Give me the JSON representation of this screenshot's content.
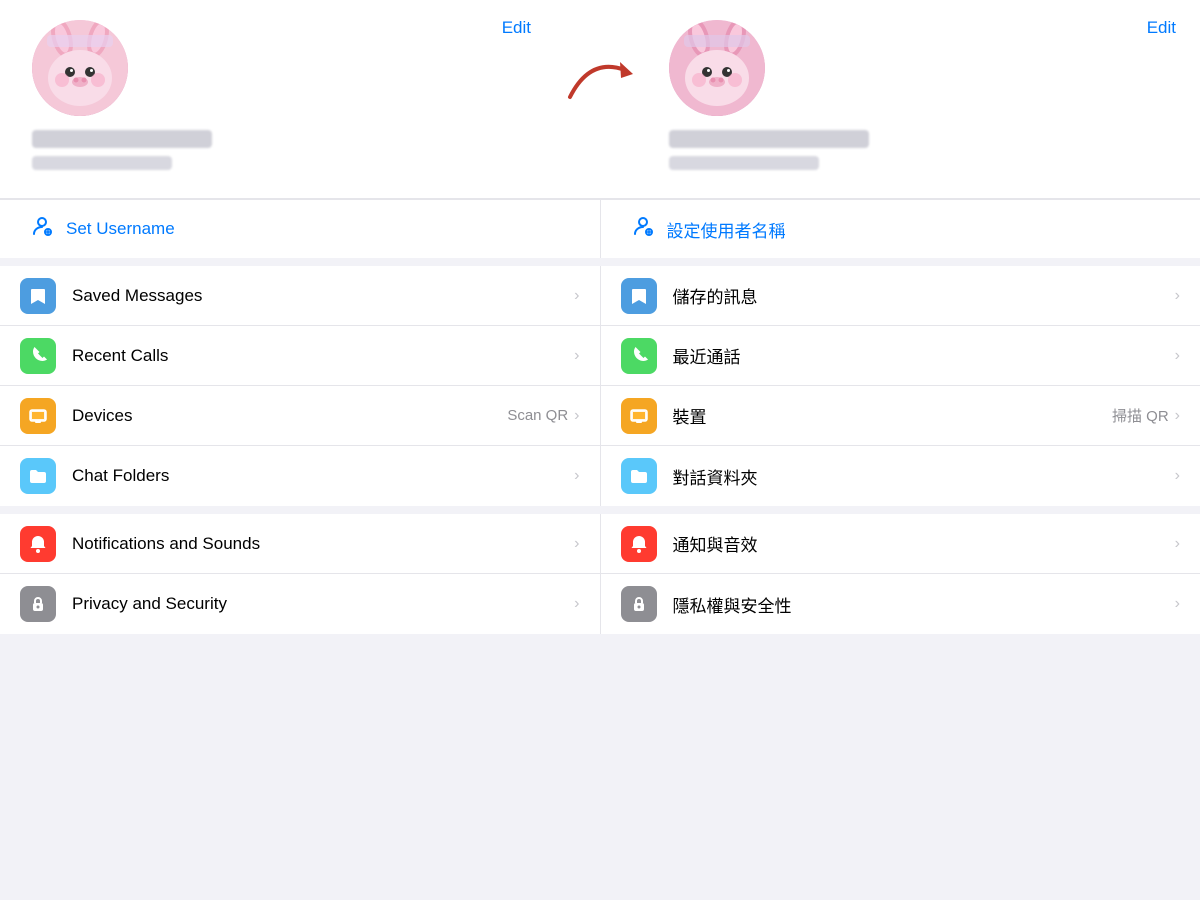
{
  "header": {
    "edit_label": "Edit"
  },
  "left_profile": {
    "edit_label": "Edit"
  },
  "right_profile": {
    "edit_label": "Edit"
  },
  "username": {
    "left_label": "Set Username",
    "right_label": "設定使用者名稱"
  },
  "menu_groups": [
    {
      "items_left": [
        {
          "icon": "bookmark",
          "label": "Saved Messages",
          "badge": "",
          "color": "blue"
        },
        {
          "icon": "phone",
          "label": "Recent Calls",
          "badge": "",
          "color": "green"
        },
        {
          "icon": "monitor",
          "label": "Devices",
          "badge": "Scan QR",
          "color": "orange"
        },
        {
          "icon": "folder",
          "label": "Chat Folders",
          "badge": "",
          "color": "teal"
        }
      ],
      "items_right": [
        {
          "icon": "bookmark",
          "label": "儲存的訊息",
          "badge": "",
          "color": "blue"
        },
        {
          "icon": "phone",
          "label": "最近通話",
          "badge": "",
          "color": "green"
        },
        {
          "icon": "monitor",
          "label": "裝置",
          "badge": "掃描 QR",
          "color": "orange"
        },
        {
          "icon": "folder",
          "label": "對話資料夾",
          "badge": "",
          "color": "teal"
        }
      ]
    }
  ],
  "menu_group2": {
    "items_left": [
      {
        "icon": "bell",
        "label": "Notifications and Sounds",
        "badge": "",
        "color": "red"
      },
      {
        "icon": "lock",
        "label": "Privacy and Security",
        "badge": "",
        "color": "gray"
      }
    ],
    "items_right": [
      {
        "icon": "bell",
        "label": "通知與音效",
        "badge": "",
        "color": "red"
      },
      {
        "icon": "lock",
        "label": "隱私權與安全性",
        "badge": "",
        "color": "gray"
      }
    ]
  },
  "icons": {
    "bookmark": "🔖",
    "phone": "📞",
    "monitor": "🖥",
    "folder": "📁",
    "bell": "🔔",
    "lock": "🔒",
    "username": "👤",
    "chevron": "›"
  },
  "colors": {
    "blue": "#4d9de0",
    "green": "#4cd964",
    "orange": "#f5a623",
    "teal": "#5ac8fa",
    "red": "#ff3b30",
    "gray": "#8e8e93",
    "accent": "#007aff"
  }
}
